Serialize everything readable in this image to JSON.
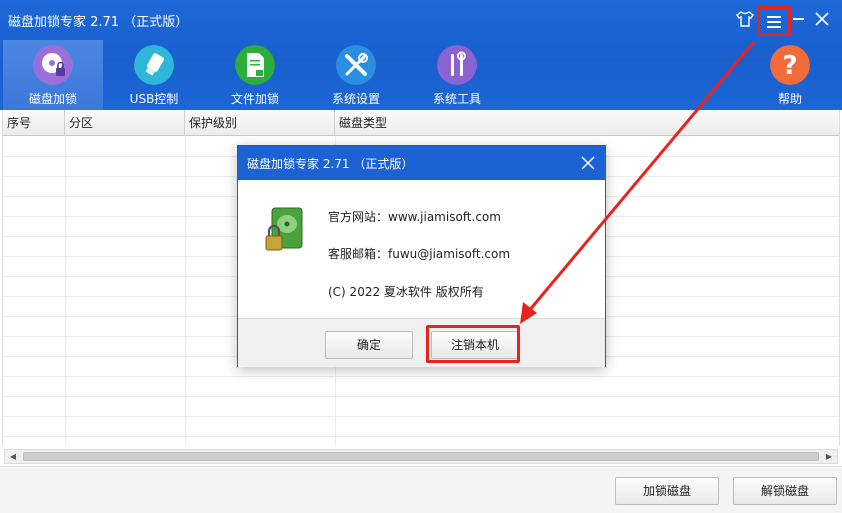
{
  "app": {
    "title": "磁盘加锁专家 2.71 （正式版）"
  },
  "colors": {
    "titlebar": "#1c68d8",
    "accent_red": "#e8231f"
  },
  "nav": [
    {
      "label": "磁盘加锁",
      "icon": "disk-lock-icon",
      "active": true
    },
    {
      "label": "USB控制",
      "icon": "usb-icon",
      "active": false
    },
    {
      "label": "文件加锁",
      "icon": "file-lock-icon",
      "active": false
    },
    {
      "label": "系统设置",
      "icon": "tools-icon",
      "active": false
    },
    {
      "label": "系统工具",
      "icon": "wrench-screwdriver-icon",
      "active": false
    },
    {
      "label": "帮助",
      "icon": "help-icon",
      "active": false
    }
  ],
  "table": {
    "headers": [
      "序号",
      "分区",
      "保护级别",
      "磁盘类型"
    ]
  },
  "buttons": {
    "lock": "加锁磁盘",
    "unlock": "解锁磁盘"
  },
  "dialog": {
    "title": "磁盘加锁专家 2.71 （正式版）",
    "website": "官方网站：www.jiamisoft.com",
    "email": "客服邮箱：fuwu@jiamisoft.com",
    "copyright": "(C)  2022 夏冰软件 版权所有",
    "ok": "确定",
    "deregister": "注销本机"
  }
}
